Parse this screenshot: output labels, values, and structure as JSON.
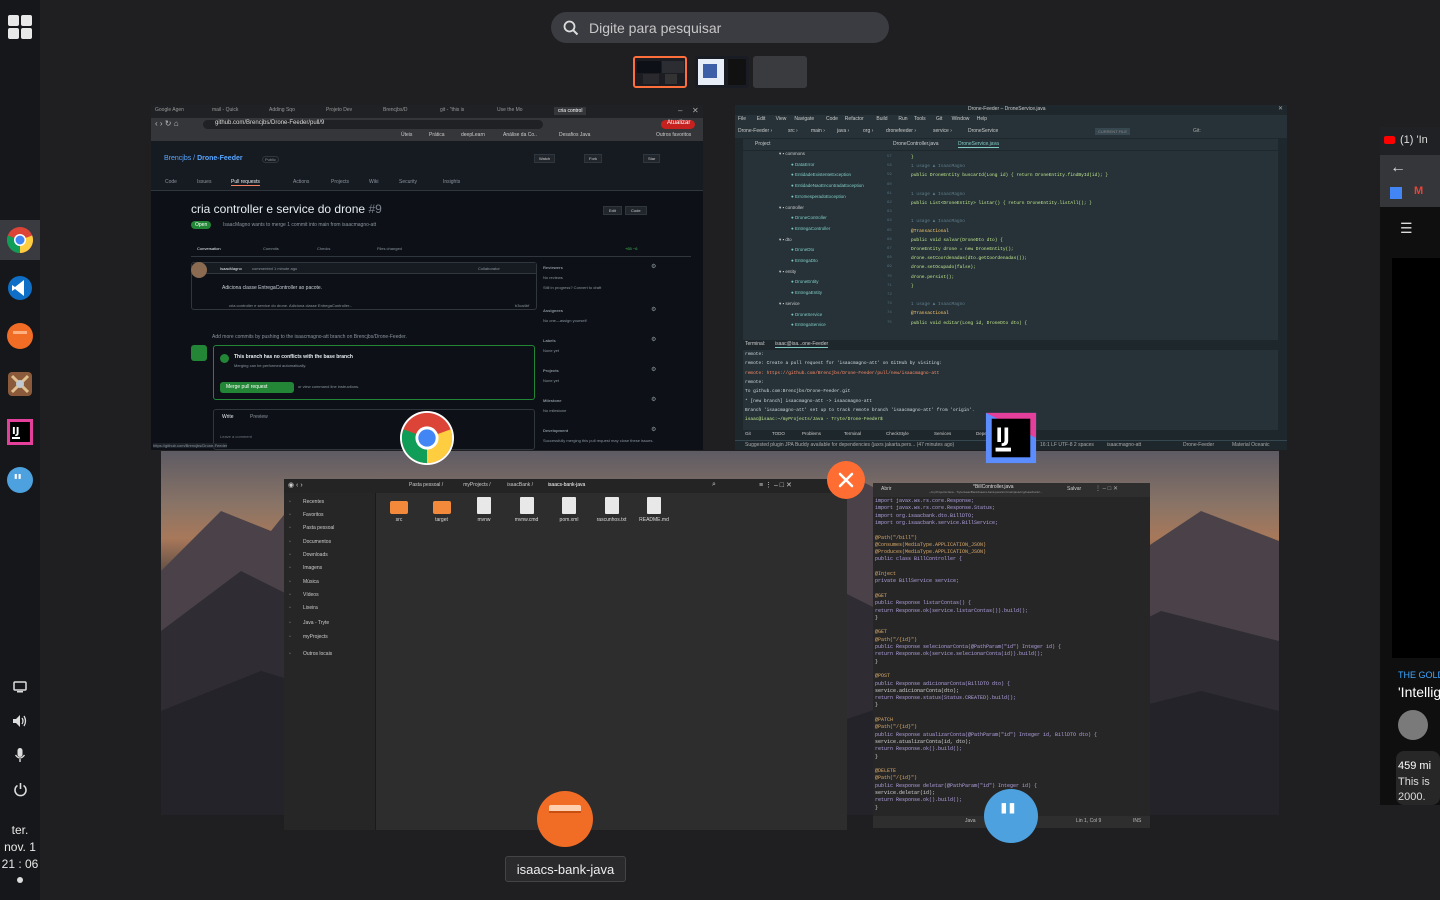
{
  "search": {
    "placeholder": "Digite para pesquisar"
  },
  "clock": {
    "day": "ter.",
    "date": "nov. 1",
    "time": "21 : 06"
  },
  "dock": {
    "apps": [
      "app-grid",
      "chrome",
      "vscode",
      "files",
      "tool",
      "intellij",
      "quotes"
    ],
    "tray": [
      "screen",
      "volume",
      "mic",
      "power"
    ]
  },
  "chrome_window": {
    "tabs": [
      "Google Agen",
      "mail - Quick",
      "Adding Sqo",
      "Projeto Dev",
      "Brencjbs/D",
      "git - \"this is",
      "Use the Mo",
      "cria control"
    ],
    "url": "github.com/Brencjbs/Drone-Feeder/pull/9",
    "update_btn": "Atualizar",
    "bookmarks": [
      "Úteis",
      "Prática",
      "deepLearn",
      "Análise da Co..",
      "Desafios Java",
      "Outros favoritos"
    ],
    "repo_owner": "Brencjbs",
    "repo_name": "Drone-Feeder",
    "public_badge": "Public",
    "repo_buttons": [
      "Watch",
      "Fork",
      "Star"
    ],
    "repo_tabs": [
      "Code",
      "Issues",
      "Pull requests",
      "Actions",
      "Projects",
      "Wiki",
      "Security",
      "Insights"
    ],
    "pr_title": "cria controller e service do drone",
    "pr_number": "#9",
    "pr_state": "Open",
    "pr_meta": "IsaacMagno wants to merge 1 commit into main from isaacmagno-att",
    "pr_edit": "Edit",
    "pr_code": "Code",
    "pr_tabs": [
      "Conversation",
      "Commits",
      "Checks",
      "Files changed"
    ],
    "diffstat": "+65 −6",
    "comment_author": "IsaacMagno",
    "comment_meta": "commented 1 minute ago",
    "comment_role": "Collaborator",
    "comment_body": "Adiciona classe EntregaController ao pacote.",
    "commit_msg": "cria controller e service do drone. Adiciona classe EntregaController...",
    "commit_verified": "b3ca4bf",
    "add_commits": "Add more commits by pushing to the isaacmagno-att branch on Brencjbs/Drone-Feeder.",
    "merge_ok_title": "This branch has no conflicts with the base branch",
    "merge_ok_sub": "Merging can be performed automatically.",
    "merge_button": "Merge pull request",
    "merge_hint": "or view command line instructions.",
    "write_tab": "Write",
    "preview_tab": "Preview",
    "comment_placeholder": "Leave a comment",
    "sidebar": [
      {
        "title": "Reviewers",
        "value": "No reviews",
        "extra": "Still in progress? Convert to draft"
      },
      {
        "title": "Assignees",
        "value": "No one—assign yourself"
      },
      {
        "title": "Labels",
        "value": "None yet"
      },
      {
        "title": "Projects",
        "value": "None yet"
      },
      {
        "title": "Milestone",
        "value": "No milestone"
      },
      {
        "title": "Development",
        "value": "Successfully merging this pull request may close these issues."
      }
    ],
    "status_url": "https://github.com/Brencjbs/Drone-Feeder"
  },
  "intellij_window": {
    "title": "Drone-Feeder – DroneService.java",
    "menu": [
      "File",
      "Edit",
      "View",
      "Navigate",
      "Code",
      "Refactor",
      "Build",
      "Run",
      "Tools",
      "Git",
      "Window",
      "Help"
    ],
    "breadcrumb": [
      "Drone-Feeder",
      "src",
      "main",
      "java",
      "org",
      "dronefeeder",
      "service",
      "DroneService"
    ],
    "run_config": "CURRENT FILE",
    "git_label": "Git:",
    "project_label": "Project",
    "editor_tabs": [
      "DroneController.java",
      "DroneService.java"
    ],
    "tree": [
      "commons",
      "DataError",
      "EntidadeExistenteException",
      "EntidadeNaoEncontradaException",
      "ErroInesperadoException",
      "controller",
      "DroneController",
      "EntregaController",
      "dto",
      "DroneDto",
      "EntregaDto",
      "entity",
      "DroneEntity",
      "EntregaEntity",
      "service",
      "DroneService",
      "EntregaService"
    ],
    "code": [
      "}",
      "1 usage  ▲ IsaacMagno",
      "public DroneEntity buscarId(Long id) { return DroneEntity.findById(id); }",
      "",
      "1 usage  ▲ IsaacMagno",
      "public List<DroneEntity> listar() { return DroneEntity.listAll(); }",
      "",
      "1 usage  ▲ IsaacMagno",
      "@Transactional",
      "public void salvar(DroneDto dto) {",
      "  DroneEntity drone = new DroneEntity();",
      "  drone.setCoordenadas(dto.getCoordenadas());",
      "  drone.setOcupado(false);",
      "  drone.persist();",
      "}",
      "",
      "1 usage  ▲ IsaacMagno",
      "@Transactional",
      "public void editar(Long id, DroneDto dto) {"
    ],
    "terminal_label": "Terminal:",
    "terminal_tab": "isaac@isa...one-Feeder",
    "terminal": [
      "remote:",
      "remote: Create a pull request for 'isaacmagno-att' on GitHub by visiting:",
      "remote:      https://github.com/Brencjbs/Drone-Feeder/pull/new/isaacmagno-att",
      "remote:",
      "To github.com:Brencjbs/Drone-Feeder.git",
      " * [new branch]      isaacmagno-att -> isaacmagno-att",
      "Branch 'isaacmagno-att' set up to track remote branch 'isaacmagno-att' from 'origin'.",
      "isaac@isaac:~/myProjects/Java - Tryte/Drone-Feeder$ "
    ],
    "bottom_tabs": [
      "Git",
      "TODO",
      "Problems",
      "Terminal",
      "CheckStyle",
      "Services",
      "Dependencies"
    ],
    "status_msg": "Suggested plugin JPA Buddy available for dependencies (jaxrs jakarta.pers... (47 minutes ago)",
    "status_right": "16:1  LF  UTF-8  2 spaces",
    "status_branch": "isaacmagno-att",
    "status_project": "Drone-Feeder",
    "status_theme": "Material Oceanic"
  },
  "files_window": {
    "path": [
      "Pasta pessoal",
      "myProjects",
      "isaacBank",
      "isaacs-bank-java"
    ],
    "sidebar": [
      "Recentes",
      "Favoritos",
      "Pasta pessoal",
      "Documentos",
      "Downloads",
      "Imagens",
      "Música",
      "Vídeos",
      "Lixeira",
      "Java - Tryte",
      "myProjects",
      "Outros locais"
    ],
    "files": [
      {
        "name": "src",
        "type": "folder"
      },
      {
        "name": "target",
        "type": "folder"
      },
      {
        "name": "mvnw",
        "type": "file"
      },
      {
        "name": "mvnw.cmd",
        "type": "file"
      },
      {
        "name": "pom.xml",
        "type": "file"
      },
      {
        "name": "rascunhos.txt",
        "type": "file"
      },
      {
        "name": "README.md",
        "type": "file"
      }
    ],
    "label": "isaacs-bank-java"
  },
  "editor_window": {
    "open_btn": "Abrir",
    "title": "*BillController.java",
    "subtitle": "~/myProjects/Java - Tryte/isaacBank/isaacs-bank-java/src/main/java/org/isaacbank/...",
    "save_btn": "Salvar",
    "code": [
      "import javax.ws.rs.core.Response;",
      "import javax.ws.rs.core.Response.Status;",
      "import org.isaacbank.dto.BillDTO;",
      "import org.isaacbank.service.BillService;",
      "",
      "@Path(\"/bill\")",
      "@Consumes(MediaType.APPLICATION_JSON)",
      "@Produces(MediaType.APPLICATION_JSON)",
      "public class BillController {",
      "",
      "  @Inject",
      "  private BillService service;",
      "",
      "  @GET",
      "  public Response listarContas() {",
      "    return Response.ok(service.listarContas()).build();",
      "  }",
      "",
      "  @GET",
      "  @Path(\"/{id}\")",
      "  public Response selecionarConta(@PathParam(\"id\") Integer id) {",
      "    return Response.ok(service.selecionarConta(id)).build();",
      "  }",
      "",
      "  @POST",
      "  public Response adicionarConta(BillDTO dto) {",
      "    service.adicionarConta(dto);",
      "    return Response.status(Status.CREATED).build();",
      "  }",
      "",
      "  @PATCH",
      "  @Path(\"/{id}\")",
      "  public Response atualizarConta(@PathParam(\"id\") Integer id, BillDTO dto) {",
      "    service.atualizarConta(id, dto);",
      "    return Response.ok().build();",
      "  }",
      "",
      "  @DELETE",
      "  @Path(\"/{id}\")",
      "  public Response deletar(@PathParam(\"id\") Integer id) {",
      "    service.deletar(id);",
      "    return Response.ok().build();",
      "  }"
    ],
    "status_lang": "Java",
    "status_tab": "Largura da tabulação: 8",
    "status_pos": "Lin 1, Col 9",
    "status_ins": "INS"
  },
  "right_window": {
    "tab_title": "(1) 'In",
    "channel": "THE GOLD",
    "video_title": "'Intellig",
    "views": "459 mi",
    "desc1": "This is",
    "desc2": "2000."
  },
  "colors": {
    "accent": "#ff6f3c",
    "dock_bg": "#16171a",
    "github_green": "#238636",
    "close_btn": "#ff6d33"
  }
}
